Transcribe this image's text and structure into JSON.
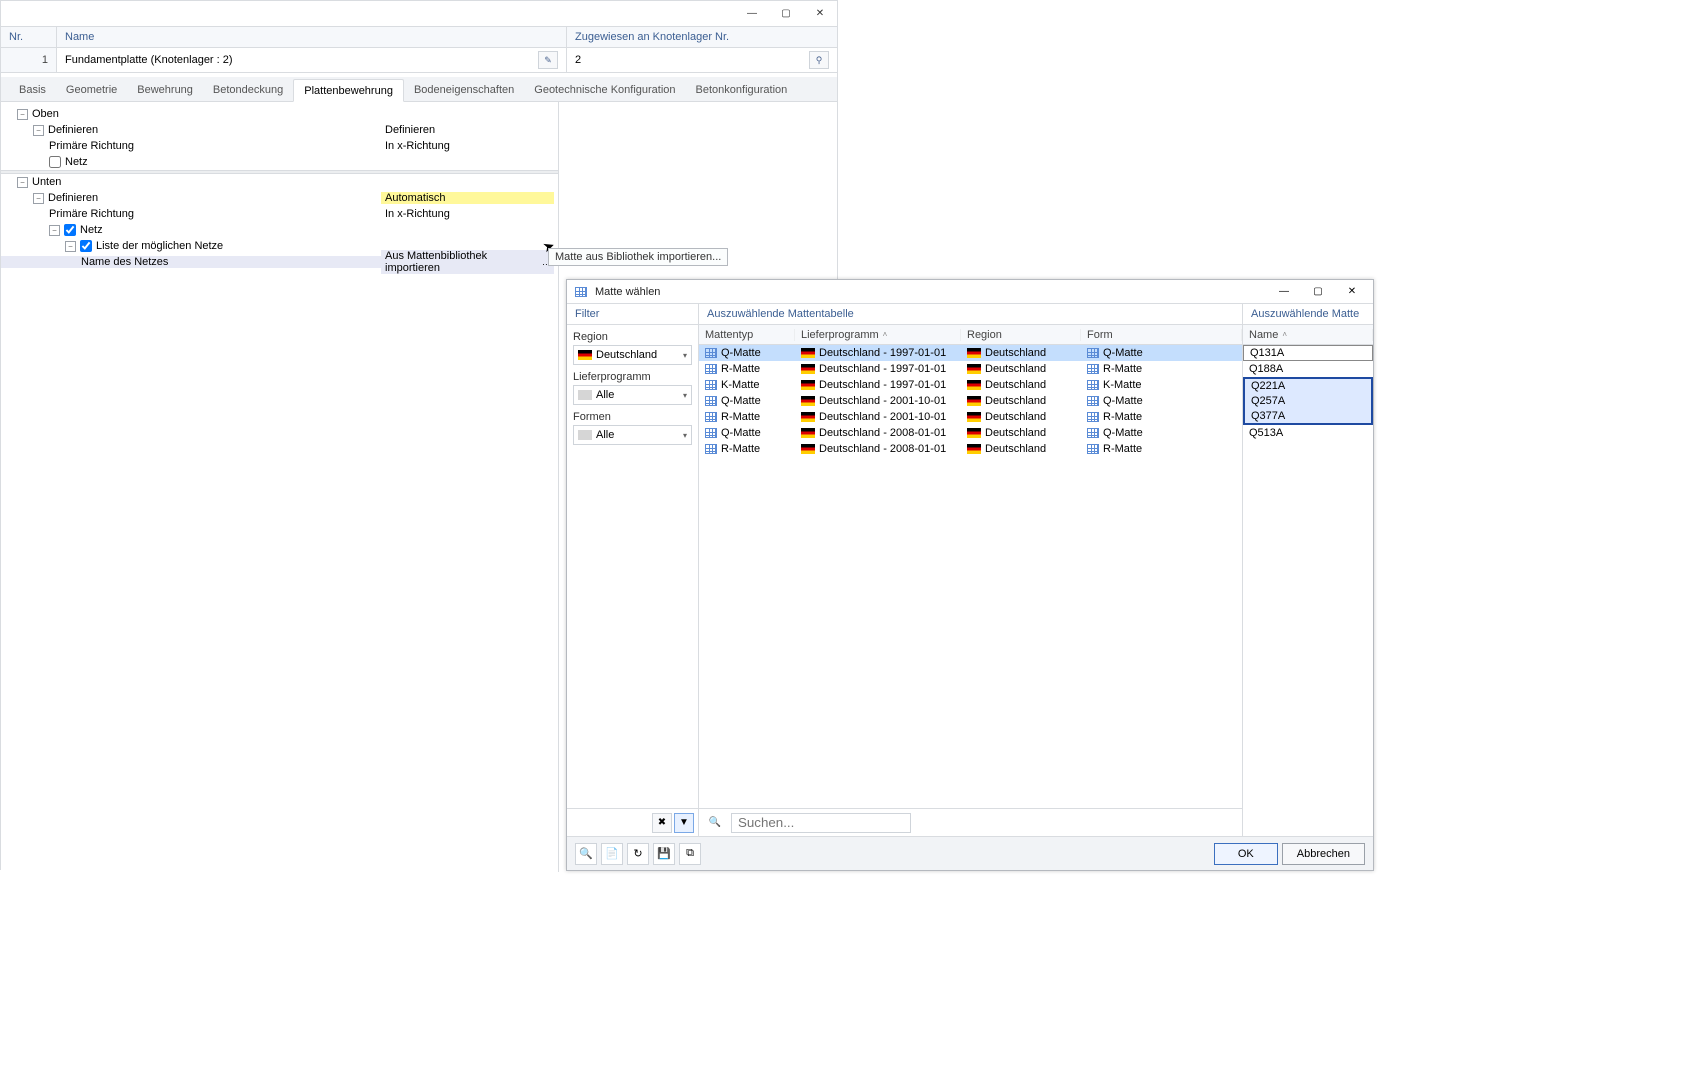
{
  "main": {
    "header": {
      "nr_label": "Nr.",
      "name_label": "Name",
      "assigned_label": "Zugewiesen an Knotenlager Nr.",
      "nr_value": "1",
      "name_value": "Fundamentplatte (Knotenlager : 2)",
      "assigned_value": "2"
    },
    "tabs": [
      "Basis",
      "Geometrie",
      "Bewehrung",
      "Betondeckung",
      "Plattenbewehrung",
      "Bodeneigenschaften",
      "Geotechnische Konfiguration",
      "Betonkonfiguration"
    ],
    "active_tab_index": 4,
    "tree": {
      "oben": "Oben",
      "oben_def": "Definieren",
      "oben_def_val": "Definieren",
      "oben_primary": "Primäre Richtung",
      "oben_primary_val": "In x-Richtung",
      "oben_netz": "Netz",
      "unten": "Unten",
      "unten_def": "Definieren",
      "unten_def_val": "Automatisch",
      "unten_primary": "Primäre Richtung",
      "unten_primary_val": "In x-Richtung",
      "unten_netz": "Netz",
      "liste": "Liste der möglichen Netze",
      "name_netz": "Name des Netzes",
      "name_netz_val": "Aus Mattenbibliothek importieren"
    },
    "tooltip": "Matte aus Bibliothek importieren..."
  },
  "dialog": {
    "title": "Matte wählen",
    "filter": {
      "head": "Filter",
      "region_lbl": "Region",
      "region_val": "Deutschland",
      "liefer_lbl": "Lieferprogramm",
      "liefer_val": "Alle",
      "formen_lbl": "Formen",
      "formen_val": "Alle"
    },
    "table": {
      "head": "Auszuwählende Mattentabelle",
      "cols": {
        "type": "Mattentyp",
        "prog": "Lieferprogramm",
        "region": "Region",
        "form": "Form"
      },
      "rows": [
        {
          "type": "Q-Matte",
          "prog": "Deutschland - 1997-01-01",
          "region": "Deutschland",
          "form": "Q-Matte"
        },
        {
          "type": "R-Matte",
          "prog": "Deutschland - 1997-01-01",
          "region": "Deutschland",
          "form": "R-Matte"
        },
        {
          "type": "K-Matte",
          "prog": "Deutschland - 1997-01-01",
          "region": "Deutschland",
          "form": "K-Matte"
        },
        {
          "type": "Q-Matte",
          "prog": "Deutschland - 2001-10-01",
          "region": "Deutschland",
          "form": "Q-Matte"
        },
        {
          "type": "R-Matte",
          "prog": "Deutschland - 2001-10-01",
          "region": "Deutschland",
          "form": "R-Matte"
        },
        {
          "type": "Q-Matte",
          "prog": "Deutschland - 2008-01-01",
          "region": "Deutschland",
          "form": "Q-Matte"
        },
        {
          "type": "R-Matte",
          "prog": "Deutschland - 2008-01-01",
          "region": "Deutschland",
          "form": "R-Matte"
        }
      ],
      "selected_index": 0
    },
    "matte": {
      "head": "Auszuwählende Matte",
      "col_name": "Name",
      "rows": [
        "Q131A",
        "Q188A",
        "Q221A",
        "Q257A",
        "Q377A",
        "Q513A"
      ],
      "editing_index": 0,
      "group_selection": [
        2,
        3,
        4
      ]
    },
    "search_placeholder": "Suchen...",
    "footer": {
      "ok": "OK",
      "cancel": "Abbrechen"
    }
  }
}
